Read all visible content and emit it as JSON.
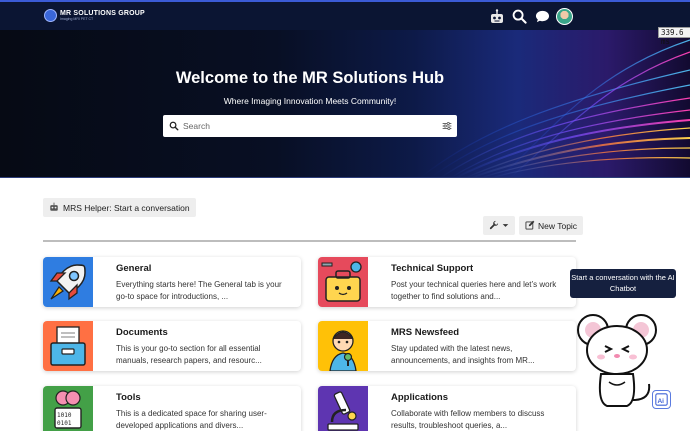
{
  "header": {
    "logo_name": "MR SOLUTIONS GROUP",
    "logo_sub": "Imaging MRI PET CT",
    "icons": [
      "robot-icon",
      "search-icon",
      "chat-icon",
      "menu-icon",
      "avatar"
    ]
  },
  "perf": {
    "timing": "339.6 ms"
  },
  "hero": {
    "title": "Welcome to the MR Solutions Hub",
    "subtitle": "Where Imaging Innovation Meets Community!",
    "search_placeholder": "Search"
  },
  "helper": {
    "label": "MRS Helper: Start a conversation"
  },
  "toolbar": {
    "new_topic": "New Topic"
  },
  "categories": [
    {
      "title": "General",
      "description": "Everything starts here! The General tab is your go-to space for introductions, ...",
      "icon": "rocket-icon",
      "color": "#2f7de1"
    },
    {
      "title": "Technical Support",
      "description": "Post your technical queries here and let’s work together to find solutions and...",
      "icon": "toolbox-icon",
      "color": "#e64a5c"
    },
    {
      "title": "Documents",
      "description": "This is your go-to section for all essential manuals, research papers, and resourc...",
      "icon": "filebox-icon",
      "color": "#ff7043"
    },
    {
      "title": "MRS Newsfeed",
      "description": "Stay updated with the latest news, announcements, and insights from MR...",
      "icon": "reporter-icon",
      "color": "#ffc107"
    },
    {
      "title": "Tools",
      "description": "This is a dedicated space for sharing user-developed applications and divers...",
      "icon": "chip-icon",
      "color": "#43a047"
    },
    {
      "title": "Applications",
      "description": "Collaborate with fellow members to discuss results, troubleshoot queries, a...",
      "icon": "microscope-icon",
      "color": "#5e35b1"
    }
  ],
  "chatbot": {
    "bubble": "Start a conversation with the AI Chatbot"
  }
}
